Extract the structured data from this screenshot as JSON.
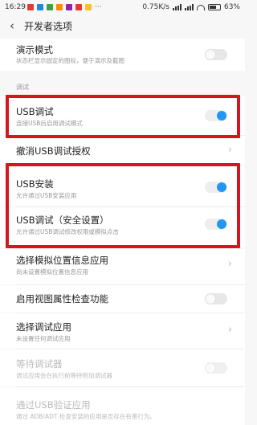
{
  "status_bar": {
    "time": "16:29",
    "net_speed": "0.75K/s",
    "battery": "63%",
    "notif_colors": [
      "#e53935",
      "#1e88e5",
      "#43a047",
      "#fb8c00",
      "#8e24aa",
      "#e53935",
      "#fbc02d"
    ]
  },
  "header": {
    "title": "开发者选项",
    "back_icon": "chevron-left-icon"
  },
  "items": {
    "demo_mode": {
      "title": "演示模式",
      "subtitle": "状态栏显示固定的图标，便于演示及截图",
      "toggle": "off"
    },
    "section_debug": "调试",
    "usb_debugging": {
      "title": "USB调试",
      "subtitle": "连接USB后启用调试模式",
      "toggle": "on"
    },
    "revoke_usb": {
      "title": "撤消USB调试授权"
    },
    "usb_install": {
      "title": "USB安装",
      "subtitle": "允许通过USB安装应用",
      "toggle": "on"
    },
    "usb_debug_security": {
      "title": "USB调试（安全设置）",
      "subtitle": "允许通过USB调试修改权限或模拟点击",
      "toggle": "on"
    },
    "mock_location": {
      "title": "选择模拟位置信息应用",
      "subtitle": "尚未设置模拟位置信息应用"
    },
    "view_attr": {
      "title": "启用视图属性检查功能",
      "toggle": "off"
    },
    "debug_app": {
      "title": "选择调试应用",
      "subtitle": "未设置任何调试应用"
    },
    "wait_debugger": {
      "title": "等待调试器",
      "subtitle": "调试应用会在执行前等待附加调试器",
      "toggle": "off"
    },
    "verify_usb": {
      "title": "通过USB验证应用",
      "subtitle": "通过 ADB/ADT 检查安装的应用是否存在有害行为。"
    }
  },
  "highlight_color": "#d8141e"
}
